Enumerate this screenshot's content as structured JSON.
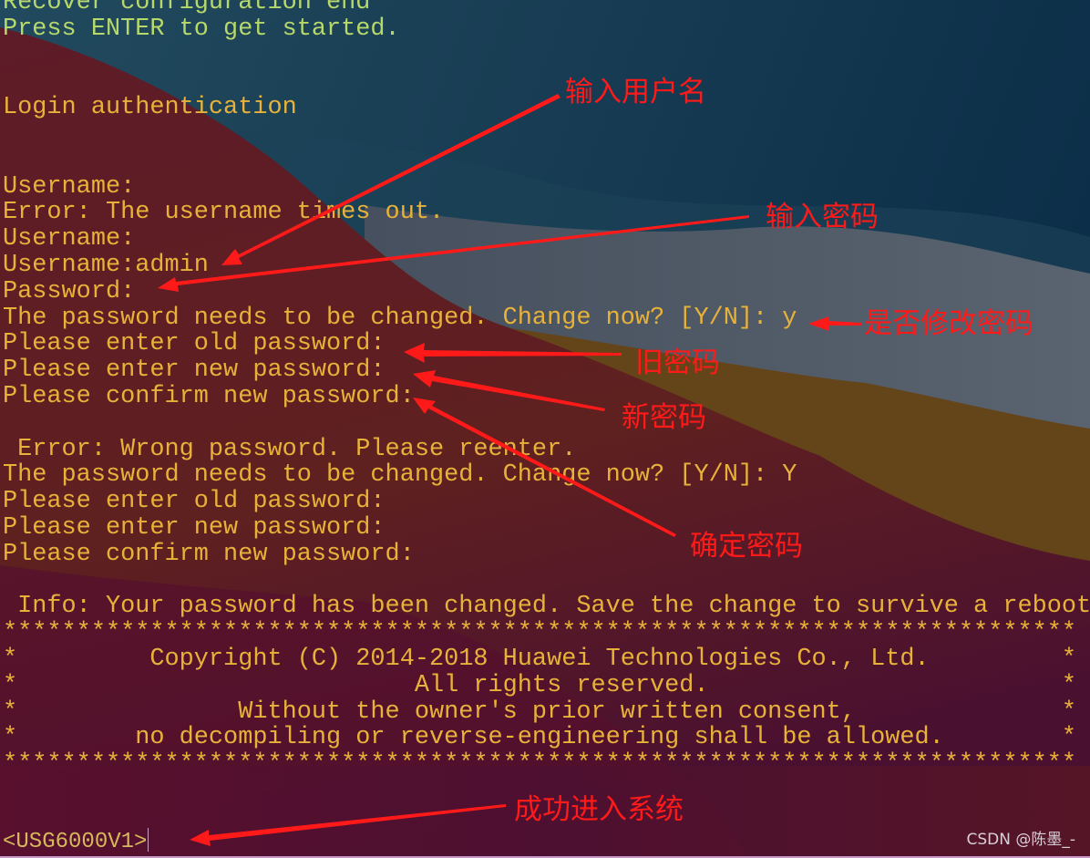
{
  "terminal": {
    "lines": [
      {
        "text": "Recover configuration end",
        "tone": "green"
      },
      {
        "text": "Press ENTER to get started.",
        "tone": "green"
      },
      {
        "text": "",
        "tone": ""
      },
      {
        "text": "",
        "tone": ""
      },
      {
        "text": "Login authentication",
        "tone": "mixed"
      },
      {
        "text": "",
        "tone": ""
      },
      {
        "text": "",
        "tone": ""
      },
      {
        "text": "Username:",
        "tone": ""
      },
      {
        "text": "Error: The username times out.",
        "tone": ""
      },
      {
        "text": "Username:",
        "tone": ""
      },
      {
        "text": "Username:admin",
        "tone": ""
      },
      {
        "text": "Password:",
        "tone": ""
      },
      {
        "text": "The password needs to be changed. Change now? [Y/N]: y",
        "tone": ""
      },
      {
        "text": "Please enter old password:",
        "tone": ""
      },
      {
        "text": "Please enter new password:",
        "tone": ""
      },
      {
        "text": "Please confirm new password:",
        "tone": ""
      },
      {
        "text": "",
        "tone": ""
      },
      {
        "text": " Error: Wrong password. Please reenter.",
        "tone": ""
      },
      {
        "text": "The password needs to be changed. Change now? [Y/N]: Y",
        "tone": ""
      },
      {
        "text": "Please enter old password:",
        "tone": ""
      },
      {
        "text": "Please enter new password:",
        "tone": ""
      },
      {
        "text": "Please confirm new password:",
        "tone": ""
      },
      {
        "text": "",
        "tone": ""
      },
      {
        "text": " Info: Your password has been changed. Save the change to survive a reboot.",
        "tone": ""
      },
      {
        "text": "*************************************************************************",
        "tone": ""
      },
      {
        "text": "*         Copyright (C) 2014-2018 Huawei Technologies Co., Ltd.         *",
        "tone": ""
      },
      {
        "text": "*                           All rights reserved.                        *",
        "tone": ""
      },
      {
        "text": "*               Without the owner's prior written consent,              *",
        "tone": ""
      },
      {
        "text": "*        no decompiling or reverse-engineering shall be allowed.        *",
        "tone": ""
      },
      {
        "text": "*************************************************************************",
        "tone": ""
      }
    ],
    "prompt": "<USG6000V1>"
  },
  "annotations": {
    "username": "输入用户名",
    "password": "输入密码",
    "change_prompt": "是否修改密码",
    "old_password": "旧密码",
    "new_password": "新密码",
    "confirm_password": "确定密码",
    "login_success": "成功进入系统"
  },
  "watermark": "CSDN @陈墨_-",
  "colors": {
    "terminal_text": "#e8b23a",
    "terminal_text_green": "#b7d86a",
    "annotation": "#ff1a1a"
  }
}
